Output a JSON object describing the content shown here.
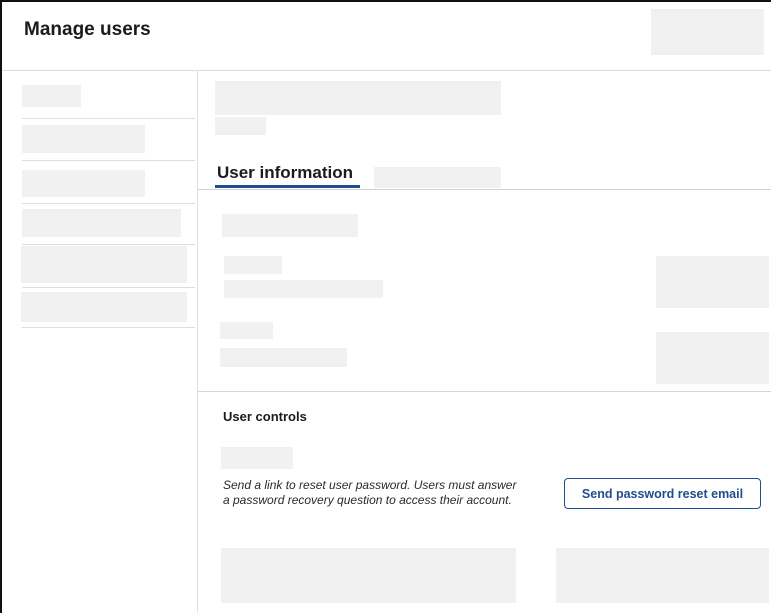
{
  "header": {
    "title": "Manage users"
  },
  "tabs": {
    "active_label": "User information"
  },
  "user_controls": {
    "heading": "User controls",
    "reset_description": "Send a link to reset user password. Users must answer a password recovery question to access their account.",
    "reset_button_label": "Send password reset email"
  },
  "colors": {
    "accent": "#1f4e8c",
    "placeholder": "#f1f1f1",
    "divider": "#dddddd"
  }
}
